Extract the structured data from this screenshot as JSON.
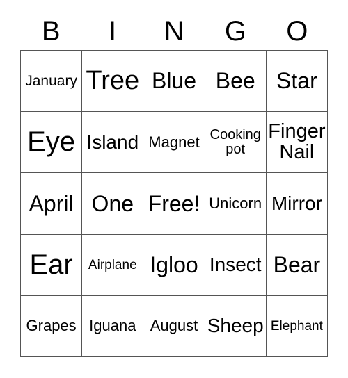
{
  "card": {
    "header_letters": [
      "B",
      "I",
      "N",
      "G",
      "O"
    ],
    "background_color": "#ffffff",
    "text_color": "#000000",
    "grid_line_color": "#555555",
    "rows": 5,
    "columns": 5,
    "free_space": "Free!",
    "cells": [
      [
        {
          "text": "January",
          "size": "xxs",
          "wrap": false
        },
        {
          "text": "Tree",
          "size": "lg",
          "wrap": false
        },
        {
          "text": "Blue",
          "size": "md",
          "wrap": false
        },
        {
          "text": "Bee",
          "size": "md",
          "wrap": false
        },
        {
          "text": "Star",
          "size": "md",
          "wrap": false
        }
      ],
      [
        {
          "text": "Eye",
          "size": "xl",
          "wrap": false
        },
        {
          "text": "Island",
          "size": "sm",
          "wrap": false
        },
        {
          "text": "Magnet",
          "size": "xs",
          "wrap": false
        },
        {
          "text": "Cooking pot",
          "size": "wrap-sm",
          "wrap": true
        },
        {
          "text": "Finger Nail",
          "size": "wrap-lg",
          "wrap": true
        }
      ],
      [
        {
          "text": "April",
          "size": "md",
          "wrap": false
        },
        {
          "text": "One",
          "size": "md",
          "wrap": false
        },
        {
          "text": "Free!",
          "size": "md",
          "wrap": false
        },
        {
          "text": "Unicorn",
          "size": "xs",
          "wrap": false
        },
        {
          "text": "Mirror",
          "size": "sm",
          "wrap": false
        }
      ],
      [
        {
          "text": "Ear",
          "size": "xl",
          "wrap": false
        },
        {
          "text": "Airplane",
          "size": "tiny",
          "wrap": false
        },
        {
          "text": "Igloo",
          "size": "md",
          "wrap": false
        },
        {
          "text": "Insect",
          "size": "sm",
          "wrap": false
        },
        {
          "text": "Bear",
          "size": "md",
          "wrap": false
        }
      ],
      [
        {
          "text": "Grapes",
          "size": "xs",
          "wrap": false
        },
        {
          "text": "Iguana",
          "size": "xs",
          "wrap": false
        },
        {
          "text": "August",
          "size": "xs",
          "wrap": false
        },
        {
          "text": "Sheep",
          "size": "sm",
          "wrap": false
        },
        {
          "text": "Elephant",
          "size": "tiny",
          "wrap": false
        }
      ]
    ]
  }
}
